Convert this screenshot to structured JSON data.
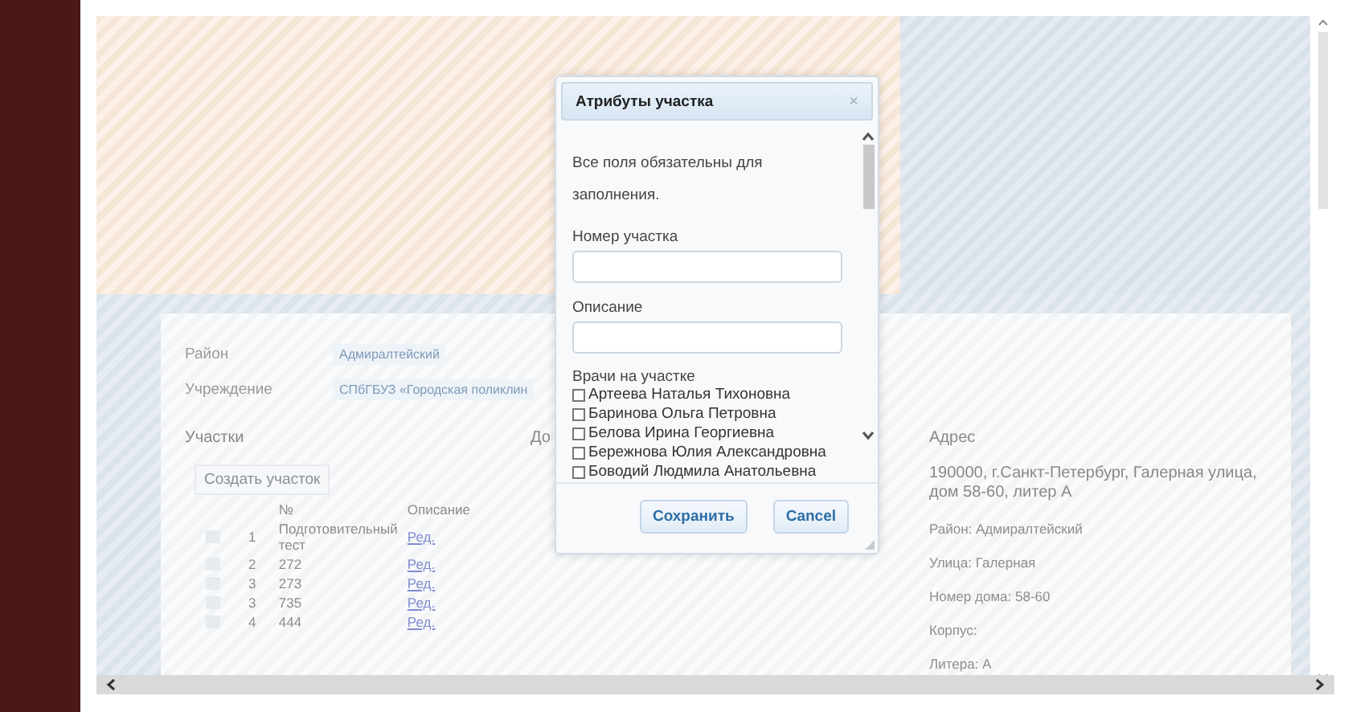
{
  "panel": {
    "fields": [
      {
        "label": "Район",
        "value": "Адмиралтейский"
      },
      {
        "label": "Учреждение",
        "value": "СПбГБУЗ «Городская поликлин"
      }
    ],
    "districts_title": "Участки",
    "column_2_title": "До",
    "address_title": "Адрес",
    "create_button": "Создать участок",
    "table": {
      "columns": [
        "№",
        "Описание"
      ],
      "rows": [
        {
          "number": "1",
          "description": "Подготовительный тест",
          "link": "Ред."
        },
        {
          "number": "2",
          "description": "272",
          "link": "Ред."
        },
        {
          "number": "3",
          "description": "273",
          "link": "Ред."
        },
        {
          "number": "3",
          "description": "735",
          "link": "Ред."
        },
        {
          "number": "4",
          "description": "444",
          "link": "Ред."
        }
      ]
    },
    "address": "190000, г.Санкт-Петербург, Галерная улица, дом 58-60, литер А",
    "address_details": [
      "Район: Адмиралтейский",
      "Улица: Галерная",
      "Номер дома: 58-60",
      "Корпус:",
      "Литера: А"
    ]
  },
  "dialog": {
    "title": "Атрибуты участка",
    "close": "×",
    "note": "Все поля обязательны для заполнения.",
    "fields": [
      {
        "label": "Номер участка"
      },
      {
        "label": "Описание"
      }
    ],
    "doctors_label": "Врачи на участке",
    "doctors": [
      {
        "name": "Артеева Наталья Тихоновна",
        "checked": false
      },
      {
        "name": "Баринова Ольга Петровна",
        "checked": false
      },
      {
        "name": "Белова Ирина Георгиевна",
        "checked": false
      },
      {
        "name": "Бережнова Юлия Александровна",
        "checked": false
      },
      {
        "name": "Боводий Людмила Анатольевна",
        "checked": false
      }
    ],
    "buttons": [
      "Сохранить",
      "Cancel"
    ]
  }
}
